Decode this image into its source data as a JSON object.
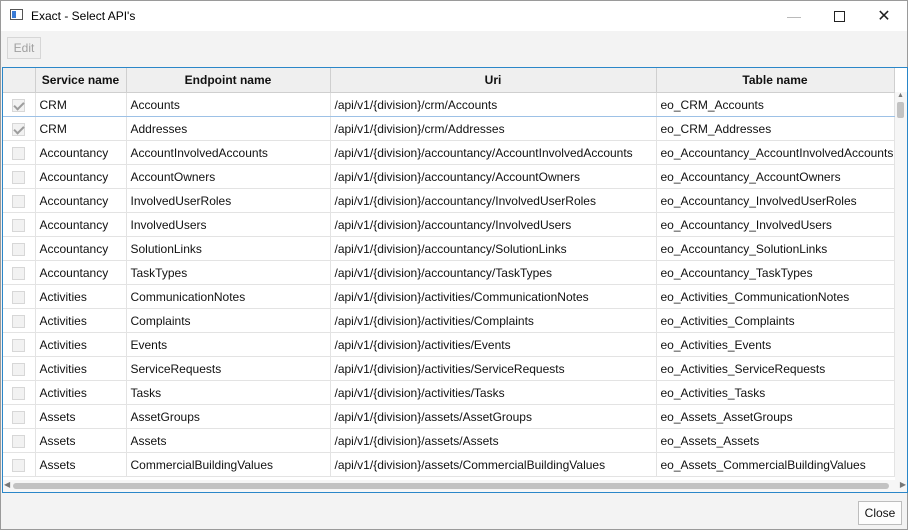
{
  "window": {
    "title": "Exact - Select API's"
  },
  "toolbar": {
    "edit_label": "Edit"
  },
  "table": {
    "columns": [
      "Service name",
      "Endpoint name",
      "Uri",
      "Table name"
    ],
    "rows": [
      {
        "checked": true,
        "service": "CRM",
        "endpoint": "Accounts",
        "uri": "/api/v1/{division}/crm/Accounts",
        "table": "eo_CRM_Accounts"
      },
      {
        "checked": true,
        "service": "CRM",
        "endpoint": "Addresses",
        "uri": "/api/v1/{division}/crm/Addresses",
        "table": "eo_CRM_Addresses"
      },
      {
        "checked": false,
        "service": "Accountancy",
        "endpoint": "AccountInvolvedAccounts",
        "uri": "/api/v1/{division}/accountancy/AccountInvolvedAccounts",
        "table": "eo_Accountancy_AccountInvolvedAccounts"
      },
      {
        "checked": false,
        "service": "Accountancy",
        "endpoint": "AccountOwners",
        "uri": "/api/v1/{division}/accountancy/AccountOwners",
        "table": "eo_Accountancy_AccountOwners"
      },
      {
        "checked": false,
        "service": "Accountancy",
        "endpoint": "InvolvedUserRoles",
        "uri": "/api/v1/{division}/accountancy/InvolvedUserRoles",
        "table": "eo_Accountancy_InvolvedUserRoles"
      },
      {
        "checked": false,
        "service": "Accountancy",
        "endpoint": "InvolvedUsers",
        "uri": "/api/v1/{division}/accountancy/InvolvedUsers",
        "table": "eo_Accountancy_InvolvedUsers"
      },
      {
        "checked": false,
        "service": "Accountancy",
        "endpoint": "SolutionLinks",
        "uri": "/api/v1/{division}/accountancy/SolutionLinks",
        "table": "eo_Accountancy_SolutionLinks"
      },
      {
        "checked": false,
        "service": "Accountancy",
        "endpoint": "TaskTypes",
        "uri": "/api/v1/{division}/accountancy/TaskTypes",
        "table": "eo_Accountancy_TaskTypes"
      },
      {
        "checked": false,
        "service": "Activities",
        "endpoint": "CommunicationNotes",
        "uri": "/api/v1/{division}/activities/CommunicationNotes",
        "table": "eo_Activities_CommunicationNotes"
      },
      {
        "checked": false,
        "service": "Activities",
        "endpoint": "Complaints",
        "uri": "/api/v1/{division}/activities/Complaints",
        "table": "eo_Activities_Complaints"
      },
      {
        "checked": false,
        "service": "Activities",
        "endpoint": "Events",
        "uri": "/api/v1/{division}/activities/Events",
        "table": "eo_Activities_Events"
      },
      {
        "checked": false,
        "service": "Activities",
        "endpoint": "ServiceRequests",
        "uri": "/api/v1/{division}/activities/ServiceRequests",
        "table": "eo_Activities_ServiceRequests"
      },
      {
        "checked": false,
        "service": "Activities",
        "endpoint": "Tasks",
        "uri": "/api/v1/{division}/activities/Tasks",
        "table": "eo_Activities_Tasks"
      },
      {
        "checked": false,
        "service": "Assets",
        "endpoint": "AssetGroups",
        "uri": "/api/v1/{division}/assets/AssetGroups",
        "table": "eo_Assets_AssetGroups"
      },
      {
        "checked": false,
        "service": "Assets",
        "endpoint": "Assets",
        "uri": "/api/v1/{division}/assets/Assets",
        "table": "eo_Assets_Assets"
      },
      {
        "checked": false,
        "service": "Assets",
        "endpoint": "CommercialBuildingValues",
        "uri": "/api/v1/{division}/assets/CommercialBuildingValues",
        "table": "eo_Assets_CommercialBuildingValues"
      }
    ]
  },
  "footer": {
    "close_label": "Close"
  },
  "icons": {
    "app": "window-app-icon",
    "minimize": "minimize-icon",
    "maximize": "maximize-icon",
    "close": "close-icon"
  },
  "colors": {
    "accent": "#2a86c8",
    "selection_border": "#9dc1e6"
  }
}
